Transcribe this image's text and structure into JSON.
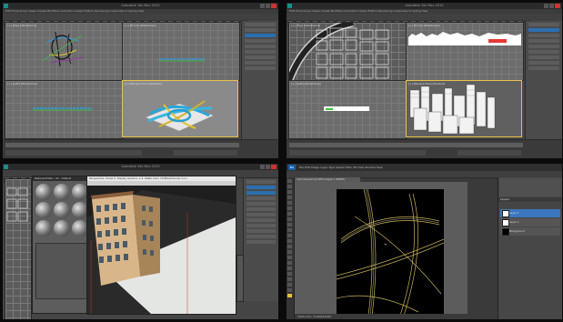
{
  "panels": [
    {
      "id": "tl",
      "app_title": "Autodesk 3ds Max 2015",
      "menu": "Edit  Tools  Group  Views  Create  Modifiers  Animation  Graph Editors  Rendering  Customize  Scripting  Help",
      "viewports": [
        "[+] [Top] [Wireframe]",
        "[+] [Front] [Wireframe]",
        "[+] [Left] [Wireframe]",
        "[+] [Perspective] [Realistic]"
      ]
    },
    {
      "id": "tr",
      "app_title": "Autodesk 3ds Max 2015",
      "menu": "Edit  Tools  Group  Views  Create  Modifiers  Animation  Graph Editors  Rendering  Customize  Scripting  Help",
      "viewports": [
        "[+] [Top] [Wireframe]",
        "[+] [Front] [Wireframe]",
        "[+] [Left] [Wireframe]",
        "[+] [Perspective] [Shaded]"
      ]
    },
    {
      "id": "bl",
      "app_title": "Autodesk 3ds Max 2015",
      "material_editor_title": "Material Editor - 01 - Default",
      "render_window_title": "Perspective, frame 0, Display Gamma: 2.2, RGBA Color 16 Bits/Channel (1:1)"
    },
    {
      "id": "br",
      "app": "Photoshop",
      "ps_logo": "Ps",
      "menu": "File  Edit  Image  Layer  Type  Select  Filter  3D  View  Window  Help",
      "doc_tab": "road_lines.psd @ 100% (Layer 1, RGB/8)",
      "layers_title": "Layers",
      "layers": [
        "Layer 2",
        "Layer 1",
        "Background"
      ],
      "status": "100%   Doc: 3.00M/6.00M"
    }
  ]
}
